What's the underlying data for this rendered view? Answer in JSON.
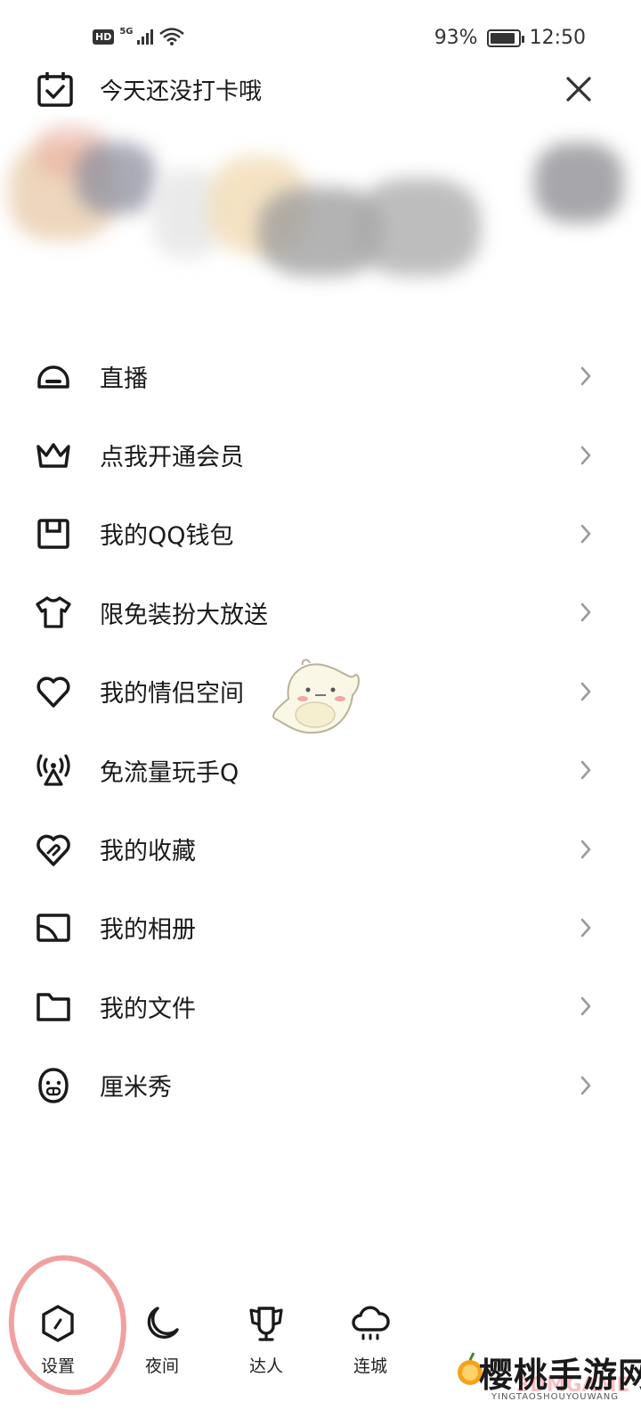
{
  "status_bar": {
    "hd_badge": "HD",
    "network": "5G",
    "battery_percent_text": "93%",
    "battery_level": 0.93,
    "time": "12:50"
  },
  "header": {
    "checkin_text": "今天还没打卡哦",
    "checkin_icon": "calendar-check-icon",
    "close_icon": "close-icon"
  },
  "menu": {
    "items": [
      {
        "label": "直播",
        "icon": "live-icon"
      },
      {
        "label": "点我开通会员",
        "icon": "crown-icon"
      },
      {
        "label": "我的QQ钱包",
        "icon": "wallet-icon"
      },
      {
        "label": "限免装扮大放送",
        "icon": "tshirt-icon"
      },
      {
        "label": "我的情侣空间",
        "icon": "heart-icon"
      },
      {
        "label": "免流量玩手Q",
        "icon": "signal-tower-icon"
      },
      {
        "label": "我的收藏",
        "icon": "favorite-icon"
      },
      {
        "label": "我的相册",
        "icon": "album-icon"
      },
      {
        "label": "我的文件",
        "icon": "folder-icon"
      },
      {
        "label": "厘米秀",
        "icon": "cmshow-face-icon"
      }
    ]
  },
  "bottom_bar": {
    "tabs": [
      {
        "label": "设置",
        "icon": "settings-icon"
      },
      {
        "label": "夜间",
        "icon": "moon-icon"
      },
      {
        "label": "达人",
        "icon": "trophy-icon"
      },
      {
        "label": "连城",
        "icon": "cloud-icon"
      }
    ]
  },
  "watermark": {
    "title": "樱桃手游网",
    "subtitle": "YINGTAOSHOUYOUWANG",
    "ghost": "3DMGAME"
  },
  "colors": {
    "text": "#1a1a1a",
    "chevron": "#9a9a9a",
    "highlight": "#ef8f90"
  }
}
